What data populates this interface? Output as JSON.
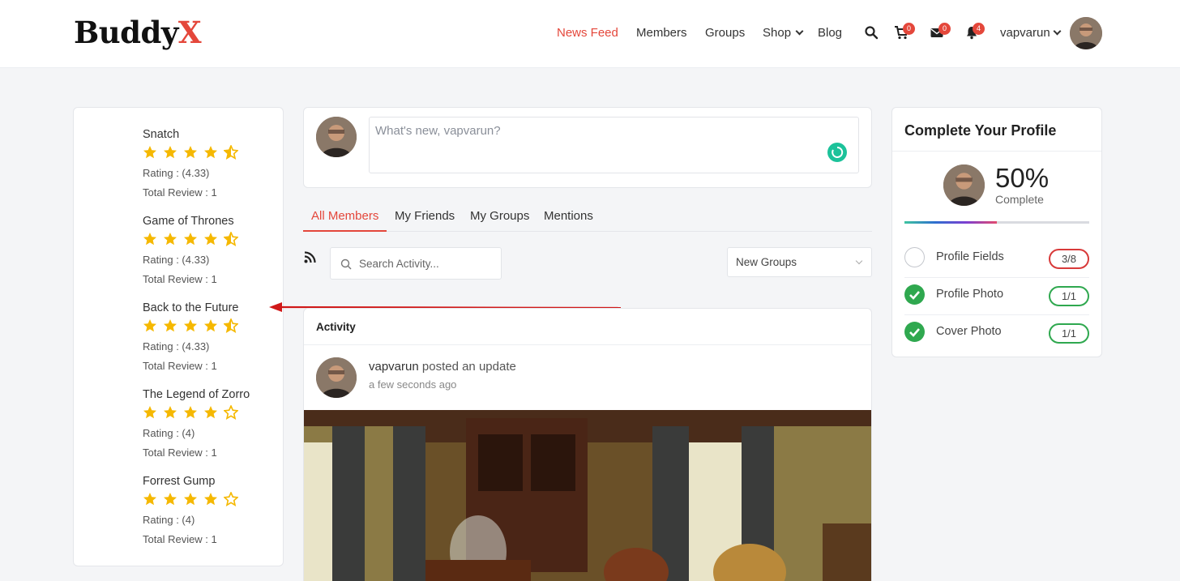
{
  "brand": {
    "name_main": "Buddy",
    "name_accent": "X"
  },
  "nav": {
    "news_feed": "News Feed",
    "members": "Members",
    "groups": "Groups",
    "shop": "Shop",
    "blog": "Blog"
  },
  "header": {
    "cart_count": "0",
    "messages_count": "0",
    "notifications_count": "4",
    "username": "vapvarun"
  },
  "reviews": [
    {
      "title": "Snatch",
      "rating_value": 4.33,
      "rating_text": "Rating : (4.33)",
      "total_text": "Total Review : 1"
    },
    {
      "title": "Game of Thrones",
      "rating_value": 4.33,
      "rating_text": "Rating : (4.33)",
      "total_text": "Total Review : 1"
    },
    {
      "title": "Back to the Future",
      "rating_value": 4.33,
      "rating_text": "Rating : (4.33)",
      "total_text": "Total Review : 1"
    },
    {
      "title": "The Legend of Zorro",
      "rating_value": 4,
      "rating_text": "Rating : (4)",
      "total_text": "Total Review : 1"
    },
    {
      "title": "Forrest Gump",
      "rating_value": 4,
      "rating_text": "Rating : (4)",
      "total_text": "Total Review : 1"
    }
  ],
  "composer": {
    "placeholder": "What's new, vapvarun?"
  },
  "tabs": [
    "All Members",
    "My Friends",
    "My Groups",
    "Mentions"
  ],
  "filters": {
    "search_placeholder": "Search Activity...",
    "select_value": "New Groups"
  },
  "activity": {
    "heading": "Activity",
    "user": "vapvarun",
    "action": "posted an update",
    "time": "a few seconds ago"
  },
  "profile": {
    "title": "Complete Your Profile",
    "percent_text": "50%",
    "percent_value": 0.5,
    "complete_label": "Complete",
    "items": [
      {
        "label": "Profile Fields",
        "count": "3/8",
        "done": false
      },
      {
        "label": "Profile Photo",
        "count": "1/1",
        "done": true
      },
      {
        "label": "Cover Photo",
        "count": "1/1",
        "done": true
      }
    ]
  },
  "colors": {
    "accent": "#e4473b",
    "star": "#f5b800",
    "success": "#2fa84f",
    "emoji_button": "#1cc29a"
  }
}
